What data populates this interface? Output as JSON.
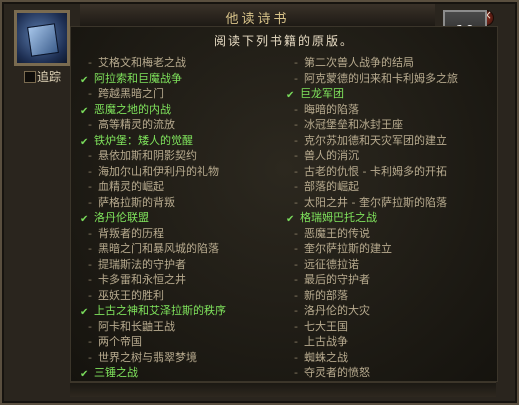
{
  "window": {
    "title": "他读诗书"
  },
  "quest_log": {
    "subtitle": "阅读下列书籍的原版。",
    "track_label": "追踪",
    "rank": "10"
  },
  "columns": {
    "left": [
      {
        "type": "item",
        "text": "艾格文和梅老之战"
      },
      {
        "type": "header",
        "text": "阿拉索和巨魔战争"
      },
      {
        "type": "item",
        "text": "跨越黑暗之门"
      },
      {
        "type": "header",
        "text": "恶魔之地的内战"
      },
      {
        "type": "item",
        "text": "高等精灵的流放"
      },
      {
        "type": "header",
        "text": "铁炉堡：矮人的觉醒"
      },
      {
        "type": "item",
        "text": "悬依加斯和阴影契约"
      },
      {
        "type": "item",
        "text": "海加尔山和伊利丹的礼物"
      },
      {
        "type": "item",
        "text": "血精灵的崛起"
      },
      {
        "type": "item",
        "text": "萨格拉斯的背叛"
      },
      {
        "type": "header",
        "text": "洛丹伦联盟"
      },
      {
        "type": "item",
        "text": "背叛者的历程"
      },
      {
        "type": "item",
        "text": "黑暗之门和暴风城的陷落"
      },
      {
        "type": "item",
        "text": "提瑞斯法的守护者"
      },
      {
        "type": "item",
        "text": "卡多雷和永恒之井"
      },
      {
        "type": "item",
        "text": "巫妖王的胜利"
      },
      {
        "type": "header",
        "text": "上古之神和艾泽拉斯的秩序"
      },
      {
        "type": "item",
        "text": "阿卡和长鼬王战"
      },
      {
        "type": "item",
        "text": "两个帝国"
      },
      {
        "type": "item",
        "text": "世界之树与翡翠梦境"
      },
      {
        "type": "header",
        "text": "三锤之战"
      }
    ],
    "right": [
      {
        "type": "item",
        "text": "第二次兽人战争的结局"
      },
      {
        "type": "item",
        "text": "阿克蒙德的归来和卡利姆多之旅"
      },
      {
        "type": "header",
        "text": "巨龙军团"
      },
      {
        "type": "item",
        "text": "晦暗的陷落"
      },
      {
        "type": "item",
        "text": "冰冠堡垒和冰封王座"
      },
      {
        "type": "item",
        "text": "克尔苏加德和天灾军团的建立"
      },
      {
        "type": "item",
        "text": "兽人的消沉"
      },
      {
        "type": "item",
        "text": "古老的仇恨 - 卡利姆多的开拓"
      },
      {
        "type": "item",
        "text": "部落的崛起"
      },
      {
        "type": "item",
        "text": "太阳之井 - 奎尔萨拉斯的陷落"
      },
      {
        "type": "header",
        "text": "格瑞姆巴托之战"
      },
      {
        "type": "item",
        "text": "恶魔王的传说"
      },
      {
        "type": "item",
        "text": "奎尔萨拉斯的建立"
      },
      {
        "type": "item",
        "text": "远征德拉诺"
      },
      {
        "type": "item",
        "text": "最后的守护者"
      },
      {
        "type": "item",
        "text": "新的部落"
      },
      {
        "type": "item",
        "text": "洛丹伦的大灾"
      },
      {
        "type": "item",
        "text": "七大王国"
      },
      {
        "type": "item",
        "text": "上古战争"
      },
      {
        "type": "item",
        "text": "蜘蛛之战"
      },
      {
        "type": "item",
        "text": "夺灵者的愤怒"
      }
    ]
  }
}
